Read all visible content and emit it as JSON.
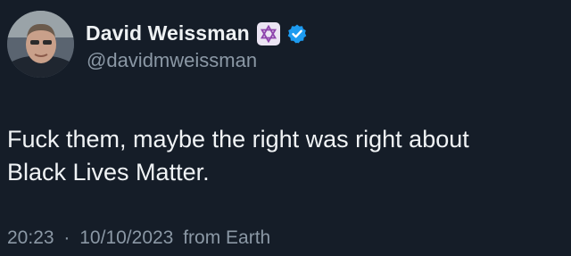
{
  "author": {
    "display_name": "David Weissman",
    "handle": "@davidmweissman",
    "badges": {
      "emoji_badge_icon": "star-of-david-icon",
      "verified_icon": "verified-check-icon",
      "verified_color": "#1d9bf0"
    }
  },
  "tweet": {
    "text_line_1": "Fuck them, maybe the right was right about",
    "text_line_2": "Black Lives Matter.",
    "time": "20:23",
    "separator": "·",
    "date": "10/10/2023",
    "source": "from Earth"
  },
  "colors": {
    "background": "#151d28",
    "text": "#e7e9ea",
    "secondary_text": "#8b98a5"
  }
}
